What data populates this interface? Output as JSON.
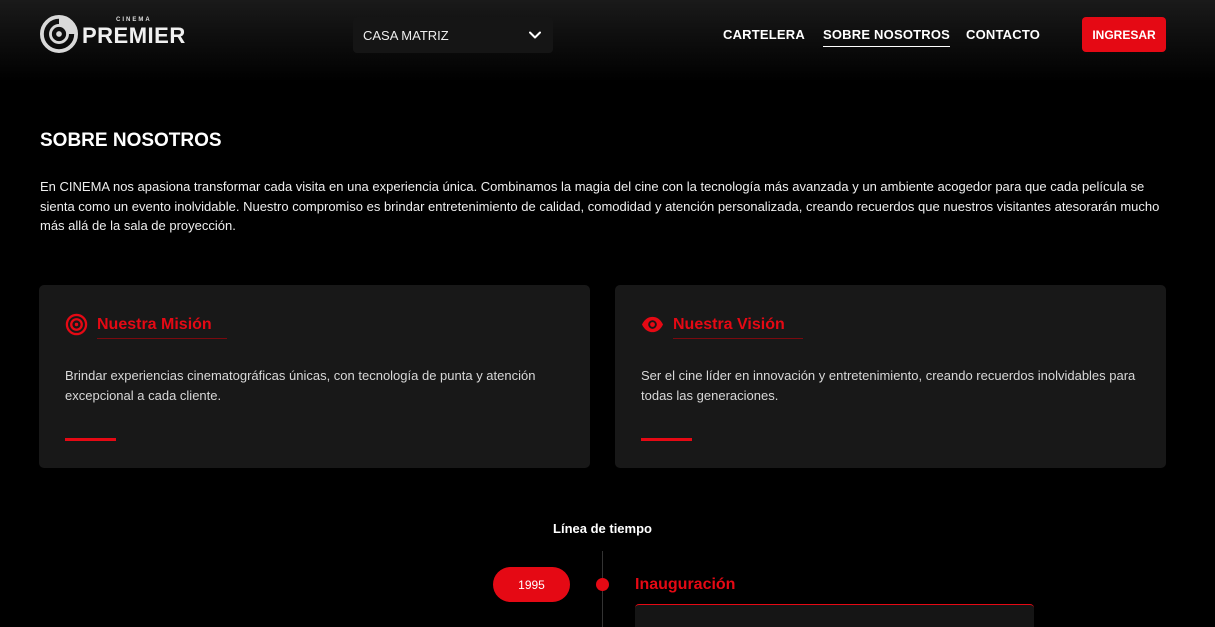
{
  "header": {
    "logo": {
      "small": "CINEMA",
      "big": "PREMIER"
    },
    "branch_select": {
      "value": "CASA MATRIZ"
    },
    "nav": [
      {
        "label": "CARTELERA",
        "active": false
      },
      {
        "label": "SOBRE NOSOTROS",
        "active": true
      },
      {
        "label": "CONTACTO",
        "active": false
      }
    ],
    "login_label": "INGRESAR"
  },
  "about": {
    "title": "SOBRE NOSOTROS",
    "intro": "En CINEMA nos apasiona transformar cada visita en una experiencia única. Combinamos la magia del cine con la tecnología más avanzada y un ambiente acogedor para que cada película se sienta como un evento inolvidable. Nuestro compromiso es brindar entretenimiento de calidad, comodidad y atención personalizada, creando recuerdos que nuestros visitantes atesorarán mucho más allá de la sala de proyección."
  },
  "cards": [
    {
      "icon": "target-icon",
      "title": "Nuestra Misión",
      "text": "Brindar experiencias cinematográficas únicas, con tecnología de punta y atención excepcional a cada cliente."
    },
    {
      "icon": "eye-icon",
      "title": "Nuestra Visión",
      "text": "Ser el cine líder en innovación y entretenimiento, creando recuerdos inolvidables para todas las generaciones."
    }
  ],
  "timeline": {
    "title": "Línea de tiempo",
    "events": [
      {
        "year": "1995",
        "title": "Inauguración"
      }
    ]
  },
  "colors": {
    "accent": "#e50914",
    "background": "#000000",
    "card": "#181818"
  }
}
